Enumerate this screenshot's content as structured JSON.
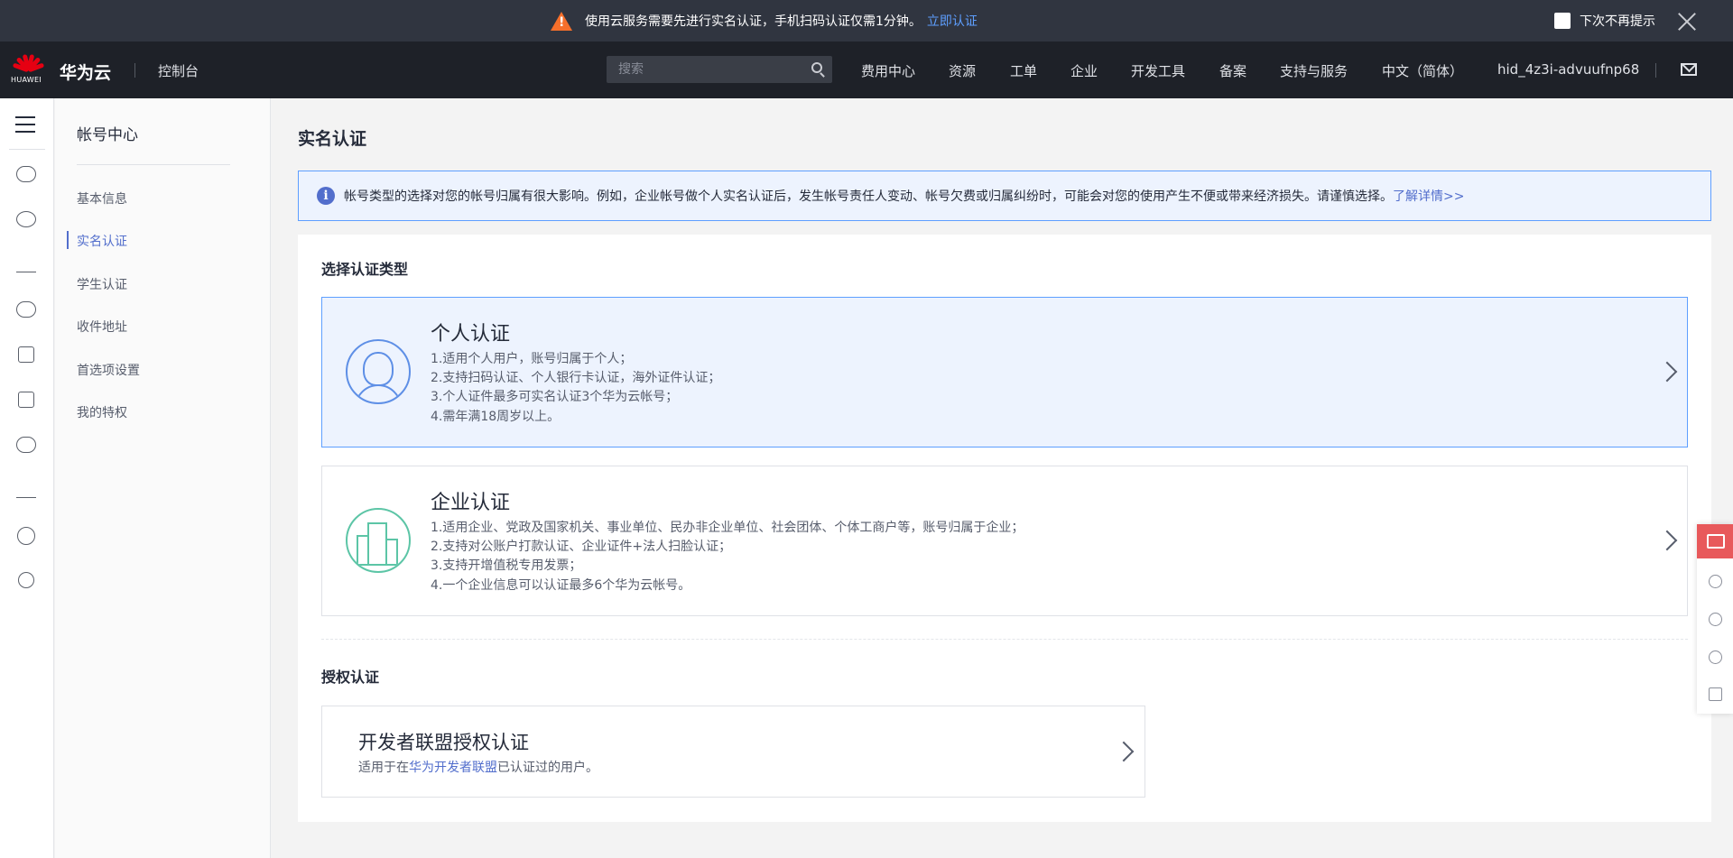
{
  "notice": {
    "message": "使用云服务需要先进行实名认证，手机扫码认证仅需1分钟。",
    "action": "立即认证",
    "dont_show": "下次不再提示"
  },
  "header": {
    "logo_text": "HUAWEI",
    "brand": "华为云",
    "console": "控制台",
    "search_placeholder": "搜索",
    "nav": [
      "费用中心",
      "资源",
      "工单",
      "企业",
      "开发工具",
      "备案",
      "支持与服务",
      "中文（简体）"
    ],
    "user": "hid_4z3i-advuufnp68"
  },
  "sidebar": {
    "title": "帐号中心",
    "items": [
      "基本信息",
      "实名认证",
      "学生认证",
      "收件地址",
      "首选项设置",
      "我的特权"
    ],
    "active": "实名认证"
  },
  "main": {
    "title": "实名认证",
    "info_text": "帐号类型的选择对您的帐号归属有很大影响。例如，企业帐号做个人实名认证后，发生帐号责任人变动、帐号欠费或归属纠纷时，可能会对您的使用产生不便或带来经济损失。请谨慎选择。",
    "info_link": "了解详情>>",
    "section1": "选择认证类型",
    "personal": {
      "title": "个人认证",
      "lines": [
        "1.适用个人用户，账号归属于个人；",
        "2.支持扫码认证、个人银行卡认证，海外证件认证；",
        "3.个人证件最多可实名认证3个华为云帐号；",
        "4.需年满18周岁以上。"
      ]
    },
    "enterprise": {
      "title": "企业认证",
      "lines": [
        "1.适用企业、党政及国家机关、事业单位、民办非企业单位、社会团体、个体工商户等，账号归属于企业；",
        "2.支持对公账户打款认证、企业证件+法人扫脸认证；",
        "3.支持开增值税专用发票；",
        "4.一个企业信息可以认证最多6个华为云帐号。"
      ]
    },
    "section2": "授权认证",
    "developer": {
      "title": "开发者联盟授权认证",
      "desc_prefix": "适用于在",
      "desc_link": "华为开发者联盟",
      "desc_suffix": "已认证过的用户。"
    }
  },
  "colors": {
    "accent": "#526ecc",
    "notice_bg": "#303540",
    "header_bg": "#1e2128",
    "selected_bg": "#edf3fe",
    "warn": "#f66f2b",
    "float_accent": "#e8595b"
  },
  "icons": [
    "warning-icon",
    "close-icon",
    "search-icon",
    "mail-icon",
    "menu-icon",
    "info-icon",
    "chevron-right-icon"
  ]
}
